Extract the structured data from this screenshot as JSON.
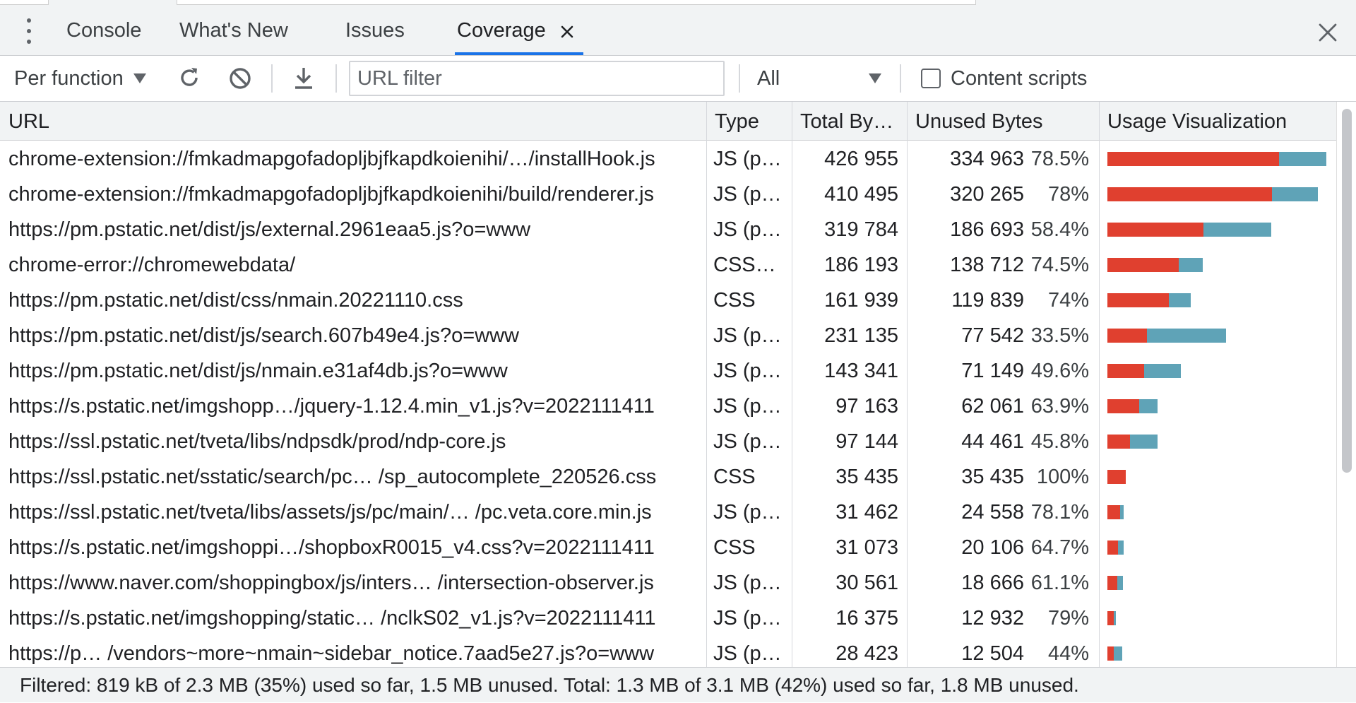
{
  "tabs": [
    {
      "label": "Console"
    },
    {
      "label": "What's New"
    },
    {
      "label": "Issues"
    },
    {
      "label": "Coverage"
    }
  ],
  "toolbar": {
    "mode_label": "Per function",
    "url_filter_placeholder": "URL filter",
    "type_filter_value": "All",
    "content_scripts_label": "Content scripts",
    "content_scripts_checked": false
  },
  "columns": {
    "url": "URL",
    "type": "Type",
    "total": "Total By…",
    "unused": "Unused Bytes",
    "viz": "Usage Visualization"
  },
  "colors": {
    "unused_bar": "#e0402f",
    "used_bar": "#5fa3b7",
    "active_tab_accent": "#1a73e8"
  },
  "rows": [
    {
      "url": "chrome-extension://fmkadmapgofadopljbjfkapdkoienihi/…/installHook.js",
      "type": "JS (p…",
      "total": "426 955",
      "unused": "334 963",
      "pct": "78.5%"
    },
    {
      "url": "chrome-extension://fmkadmapgofadopljbjfkapdkoienihi/build/renderer.js",
      "type": "JS (p…",
      "total": "410 495",
      "unused": "320 265",
      "pct": "78%"
    },
    {
      "url": "https://pm.pstatic.net/dist/js/external.2961eaa5.js?o=www",
      "type": "JS (p…",
      "total": "319 784",
      "unused": "186 693",
      "pct": "58.4%"
    },
    {
      "url": "chrome-error://chromewebdata/",
      "type": "CSS…",
      "total": "186 193",
      "unused": "138 712",
      "pct": "74.5%"
    },
    {
      "url": "https://pm.pstatic.net/dist/css/nmain.20221110.css",
      "type": "CSS",
      "total": "161 939",
      "unused": "119 839",
      "pct": "74%"
    },
    {
      "url": "https://pm.pstatic.net/dist/js/search.607b49e4.js?o=www",
      "type": "JS (p…",
      "total": "231 135",
      "unused": "77 542",
      "pct": "33.5%"
    },
    {
      "url": "https://pm.pstatic.net/dist/js/nmain.e31af4db.js?o=www",
      "type": "JS (p…",
      "total": "143 341",
      "unused": "71 149",
      "pct": "49.6%"
    },
    {
      "url": "https://s.pstatic.net/imgshopp…/jquery-1.12.4.min_v1.js?v=2022111411",
      "type": "JS (p…",
      "total": "97 163",
      "unused": "62 061",
      "pct": "63.9%"
    },
    {
      "url": "https://ssl.pstatic.net/tveta/libs/ndpsdk/prod/ndp-core.js",
      "type": "JS (p…",
      "total": "97 144",
      "unused": "44 461",
      "pct": "45.8%"
    },
    {
      "url": "https://ssl.pstatic.net/sstatic/search/pc… /sp_autocomplete_220526.css",
      "type": "CSS",
      "total": "35 435",
      "unused": "35 435",
      "pct": "100%"
    },
    {
      "url": "https://ssl.pstatic.net/tveta/libs/assets/js/pc/main/… /pc.veta.core.min.js",
      "type": "JS (p…",
      "total": "31 462",
      "unused": "24 558",
      "pct": "78.1%"
    },
    {
      "url": "https://s.pstatic.net/imgshoppi…/shopboxR0015_v4.css?v=2022111411",
      "type": "CSS",
      "total": "31 073",
      "unused": "20 106",
      "pct": "64.7%"
    },
    {
      "url": "https://www.naver.com/shoppingbox/js/inters… /intersection-observer.js",
      "type": "JS (p…",
      "total": "30 561",
      "unused": "18 666",
      "pct": "61.1%"
    },
    {
      "url": "https://s.pstatic.net/imgshopping/static… /nclkS02_v1.js?v=2022111411",
      "type": "JS (p…",
      "total": "16 375",
      "unused": "12 932",
      "pct": "79%"
    },
    {
      "url": "https://p…  /vendors~more~nmain~sidebar_notice.7aad5e27.js?o=www",
      "type": "JS (p…",
      "total": "28 423",
      "unused": "12 504",
      "pct": "44%"
    }
  ],
  "status": "Filtered: 819 kB of 2.3 MB (35%) used so far, 1.5 MB unused. Total: 1.3 MB of 3.1 MB (42%) used so far, 1.8 MB unused."
}
